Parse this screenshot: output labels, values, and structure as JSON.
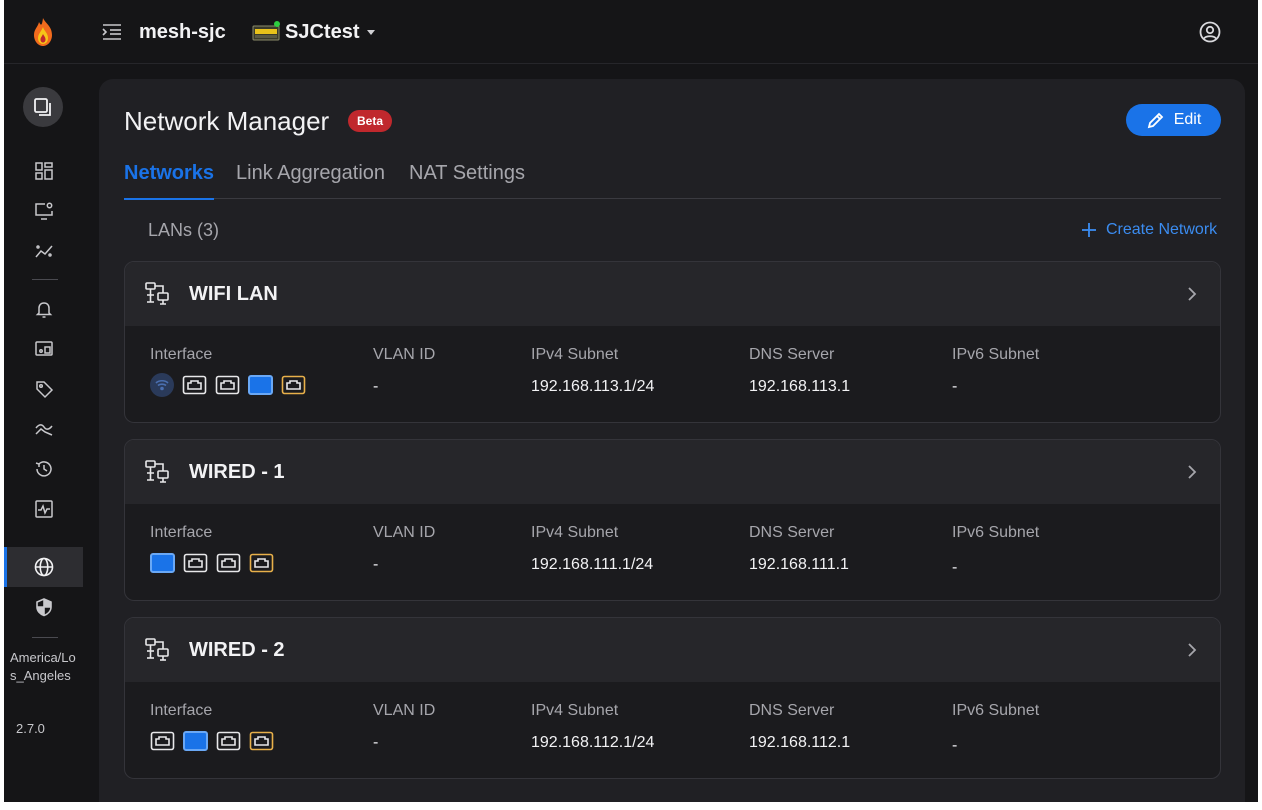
{
  "header": {
    "site_name": "mesh-sjc",
    "device_name": "SJCtest"
  },
  "sidebar": {
    "timezone": "America/Los_Angeles",
    "version": "2.7.0"
  },
  "page": {
    "title": "Network Manager",
    "badge": "Beta",
    "edit_label": "Edit",
    "tabs": [
      {
        "label": "Networks",
        "active": true
      },
      {
        "label": "Link Aggregation",
        "active": false
      },
      {
        "label": "NAT Settings",
        "active": false
      }
    ],
    "lans_title": "LANs (3)",
    "create_network_label": "Create Network",
    "columns": {
      "interface": "Interface",
      "vlan": "VLAN ID",
      "ipv4": "IPv4 Subnet",
      "dns": "DNS Server",
      "ipv6": "IPv6 Subnet"
    }
  },
  "networks": [
    {
      "name": "WIFI LAN",
      "vlan": "-",
      "ipv4": "192.168.113.1/24",
      "dns": "192.168.113.1",
      "ipv6": "-",
      "interfaces": [
        "wifi",
        "ethernet",
        "ethernet",
        "selected",
        "wan"
      ]
    },
    {
      "name": "WIRED - 1",
      "vlan": "-",
      "ipv4": "192.168.111.1/24",
      "dns": "192.168.111.1",
      "ipv6": "-",
      "interfaces": [
        "selected",
        "ethernet",
        "ethernet",
        "wan"
      ]
    },
    {
      "name": "WIRED - 2",
      "vlan": "-",
      "ipv4": "192.168.112.1/24",
      "dns": "192.168.112.1",
      "ipv6": "-",
      "interfaces": [
        "ethernet",
        "selected",
        "ethernet",
        "wan"
      ]
    }
  ],
  "colors": {
    "accent": "#1a73e8",
    "badge": "#c0282d",
    "wan_port": "#e8b04a"
  }
}
